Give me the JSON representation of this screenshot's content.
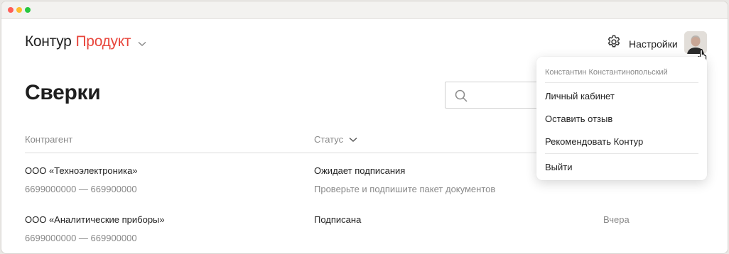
{
  "header": {
    "logo_main": "Контур",
    "logo_product": "Продукт",
    "settings_label": "Настройки"
  },
  "page": {
    "title": "Сверки"
  },
  "table": {
    "columns": [
      "Контрагент",
      "Статус"
    ],
    "rows": [
      {
        "name": "ООО «Техноэлектроника»",
        "inn": "6699000000 — 669900000",
        "status": "Ожидает подписания",
        "status_hint": "Проверьте и подпишите пакет документов",
        "date": ""
      },
      {
        "name": "ООО «Аналитические приборы»",
        "inn": "6699000000 — 669900000",
        "status": "Подписана",
        "status_hint": "",
        "date": "Вчера"
      }
    ]
  },
  "user_menu": {
    "user_name": "Константин Константинопольский",
    "items": [
      "Личный кабинет",
      "Оставить отзыв",
      "Рекомендовать Контур"
    ],
    "logout": "Выйти"
  },
  "colors": {
    "brand_red": "#e8463c"
  },
  "icons": [
    "chevron-down-icon",
    "gear-icon",
    "search-icon",
    "hand-cursor-icon"
  ]
}
